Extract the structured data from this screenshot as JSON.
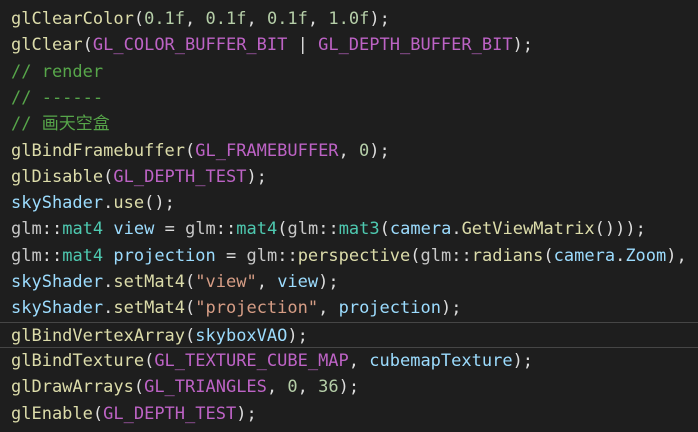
{
  "colors": {
    "background": "#1e1e1e",
    "function": "#dcdcaa",
    "plain": "#dcdcdc",
    "number": "#b5cea8",
    "macro": "#bd63c5",
    "comment": "#57a64a",
    "variable": "#9cdcfe",
    "type": "#4ec9b0",
    "namespace": "#c8c8c8",
    "string": "#d69d85",
    "current_line_border": "#464646"
  },
  "current_line": 12,
  "lines": [
    [
      [
        "fn",
        "glClearColor"
      ],
      [
        "plain",
        "("
      ],
      [
        "num",
        "0.1f"
      ],
      [
        "plain",
        ", "
      ],
      [
        "num",
        "0.1f"
      ],
      [
        "plain",
        ", "
      ],
      [
        "num",
        "0.1f"
      ],
      [
        "plain",
        ", "
      ],
      [
        "num",
        "1.0f"
      ],
      [
        "plain",
        ");"
      ]
    ],
    [
      [
        "fn",
        "glClear"
      ],
      [
        "plain",
        "("
      ],
      [
        "macro",
        "GL_COLOR_BUFFER_BIT"
      ],
      [
        "plain",
        " | "
      ],
      [
        "macro",
        "GL_DEPTH_BUFFER_BIT"
      ],
      [
        "plain",
        ");"
      ]
    ],
    [
      [
        "comment",
        "// render"
      ]
    ],
    [
      [
        "comment",
        "// ------"
      ]
    ],
    [
      [
        "comment",
        "// 画天空盒"
      ]
    ],
    [
      [
        "fn",
        "glBindFramebuffer"
      ],
      [
        "plain",
        "("
      ],
      [
        "macro",
        "GL_FRAMEBUFFER"
      ],
      [
        "plain",
        ", "
      ],
      [
        "num",
        "0"
      ],
      [
        "plain",
        ");"
      ]
    ],
    [
      [
        "fn",
        "glDisable"
      ],
      [
        "plain",
        "("
      ],
      [
        "macro",
        "GL_DEPTH_TEST"
      ],
      [
        "plain",
        ");"
      ]
    ],
    [
      [
        "var",
        "skyShader"
      ],
      [
        "plain",
        "."
      ],
      [
        "fn",
        "use"
      ],
      [
        "plain",
        "();"
      ]
    ],
    [
      [
        "ns",
        "glm"
      ],
      [
        "plain",
        "::"
      ],
      [
        "type",
        "mat4"
      ],
      [
        "plain",
        " "
      ],
      [
        "var",
        "view"
      ],
      [
        "plain",
        " = "
      ],
      [
        "ns",
        "glm"
      ],
      [
        "plain",
        "::"
      ],
      [
        "type",
        "mat4"
      ],
      [
        "plain",
        "("
      ],
      [
        "ns",
        "glm"
      ],
      [
        "plain",
        "::"
      ],
      [
        "type",
        "mat3"
      ],
      [
        "plain",
        "("
      ],
      [
        "var",
        "camera"
      ],
      [
        "plain",
        "."
      ],
      [
        "fn",
        "GetViewMatrix"
      ],
      [
        "plain",
        "()));"
      ]
    ],
    [
      [
        "ns",
        "glm"
      ],
      [
        "plain",
        "::"
      ],
      [
        "type",
        "mat4"
      ],
      [
        "plain",
        " "
      ],
      [
        "var",
        "projection"
      ],
      [
        "plain",
        " = "
      ],
      [
        "ns",
        "glm"
      ],
      [
        "plain",
        "::"
      ],
      [
        "fn",
        "perspective"
      ],
      [
        "plain",
        "("
      ],
      [
        "ns",
        "glm"
      ],
      [
        "plain",
        "::"
      ],
      [
        "fn",
        "radians"
      ],
      [
        "plain",
        "("
      ],
      [
        "var",
        "camera"
      ],
      [
        "plain",
        "."
      ],
      [
        "var",
        "Zoom"
      ],
      [
        "plain",
        "),"
      ]
    ],
    [
      [
        "var",
        "skyShader"
      ],
      [
        "plain",
        "."
      ],
      [
        "fn",
        "setMat4"
      ],
      [
        "plain",
        "("
      ],
      [
        "str",
        "\"view\""
      ],
      [
        "plain",
        ", "
      ],
      [
        "var",
        "view"
      ],
      [
        "plain",
        ");"
      ]
    ],
    [
      [
        "var",
        "skyShader"
      ],
      [
        "plain",
        "."
      ],
      [
        "fn",
        "setMat4"
      ],
      [
        "plain",
        "("
      ],
      [
        "str",
        "\"projection\""
      ],
      [
        "plain",
        ", "
      ],
      [
        "var",
        "projection"
      ],
      [
        "plain",
        ");"
      ]
    ],
    [
      [
        "fn",
        "glBindVertexArray"
      ],
      [
        "plain",
        "("
      ],
      [
        "var",
        "skyboxVAO"
      ],
      [
        "plain",
        ");"
      ]
    ],
    [
      [
        "fn",
        "glBindTexture"
      ],
      [
        "plain",
        "("
      ],
      [
        "macro",
        "GL_TEXTURE_CUBE_MAP"
      ],
      [
        "plain",
        ", "
      ],
      [
        "var",
        "cubemapTexture"
      ],
      [
        "plain",
        ");"
      ]
    ],
    [
      [
        "fn",
        "glDrawArrays"
      ],
      [
        "plain",
        "("
      ],
      [
        "macro",
        "GL_TRIANGLES"
      ],
      [
        "plain",
        ", "
      ],
      [
        "num",
        "0"
      ],
      [
        "plain",
        ", "
      ],
      [
        "num",
        "36"
      ],
      [
        "plain",
        ");"
      ]
    ],
    [
      [
        "fn",
        "glEnable"
      ],
      [
        "plain",
        "("
      ],
      [
        "macro",
        "GL_DEPTH_TEST"
      ],
      [
        "plain",
        ");"
      ]
    ]
  ]
}
